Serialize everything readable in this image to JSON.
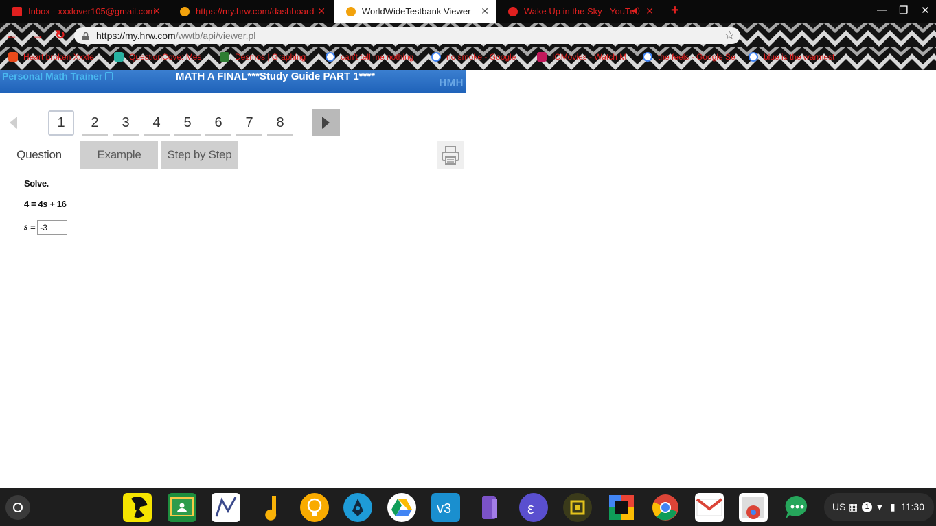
{
  "browser": {
    "tabs": [
      {
        "title": "Inbox - xxxlover105@gmail.com",
        "active": false,
        "color": "#e0201f"
      },
      {
        "title": "https://my.hrw.com/dashboard",
        "active": false,
        "color": "#f2a20c"
      },
      {
        "title": "WorldWideTestbank Viewer",
        "active": true,
        "color": "#f2a20c"
      },
      {
        "title": "Wake Up in the Sky - YouTube",
        "active": false,
        "color": "#e0201f"
      }
    ],
    "url_host": "https://my.hrw.com",
    "url_path": "/wwtb/api/viewer.pl",
    "bookmarks": [
      "Heart broken Xxxte",
      "QuestionCove: Mes",
      "Desmos | Graphing",
      "can't tell me nothing",
      "no smoke - Google",
      "IOMovies - Watch M",
      "the feels - Google Se",
      "blue is the warmest"
    ]
  },
  "viewer": {
    "brand_link": "Personal Math Trainer",
    "title": "MATH A FINAL***Study Guide PART 1****",
    "publisher_logo": "HMH",
    "pages": [
      "1",
      "2",
      "3",
      "4",
      "5",
      "6",
      "7",
      "8"
    ],
    "current_page": "1",
    "tabs": {
      "question": "Question",
      "example": "Example",
      "step_by_step": "Step by Step"
    },
    "question": {
      "instruction": "Solve.",
      "equation_lhs": "4 = 4",
      "equation_var": "s",
      "equation_rhs": " + 16",
      "answer_var": "s",
      "answer_equals": "=",
      "answer_value": "-3"
    }
  },
  "system": {
    "keyboard_layout": "US",
    "notification_count": "1",
    "time": "11:30"
  },
  "colors": {
    "banner": "#2a6ec4",
    "accent_red": "#e0201f",
    "brand_link": "#49b8f0"
  }
}
